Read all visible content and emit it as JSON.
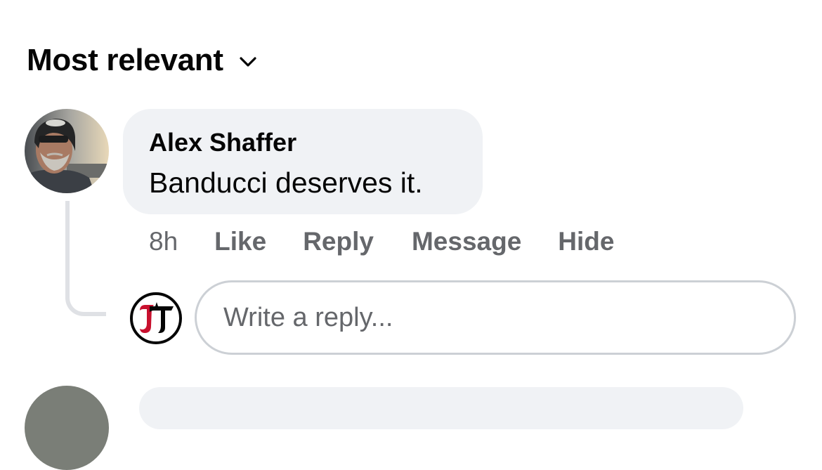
{
  "sort": {
    "label": "Most relevant",
    "icon": "chevron-down-icon"
  },
  "comment": {
    "author": "Alex Shaffer",
    "text": "Banducci deserves it.",
    "time": "8h",
    "actions": {
      "like": "Like",
      "reply": "Reply",
      "message": "Message",
      "hide": "Hide"
    }
  },
  "reply_composer": {
    "placeholder": "Write a reply...",
    "value": ""
  },
  "colors": {
    "bubble_bg": "#f0f2f5",
    "secondary_text": "#65676b",
    "primary_text": "#050505",
    "logo_red": "#c8102e"
  }
}
